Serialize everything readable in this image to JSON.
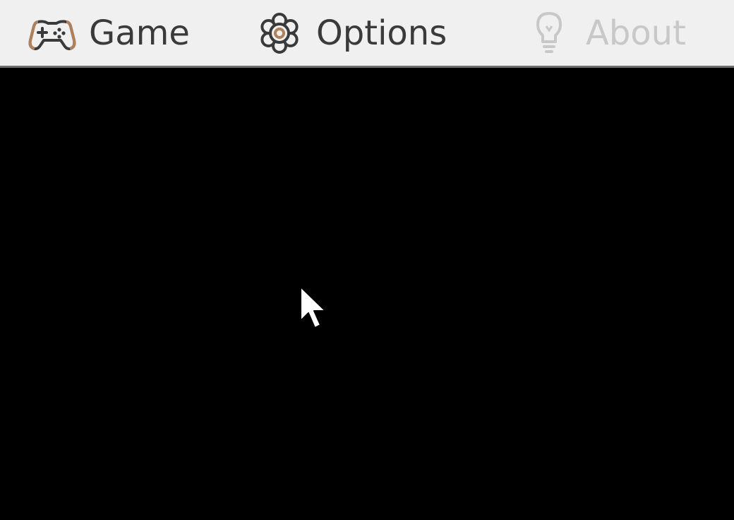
{
  "menubar": {
    "items": [
      {
        "label": "Game",
        "icon": "gamepad-icon",
        "enabled": true
      },
      {
        "label": "Options",
        "icon": "gear-icon",
        "enabled": true
      },
      {
        "label": "About",
        "icon": "lightbulb-icon",
        "enabled": false
      }
    ]
  },
  "colors": {
    "menubar_bg": "#f0f0f0",
    "menu_text": "#3a3a3a",
    "menu_text_disabled": "#c8c8c8",
    "canvas_bg": "#000000",
    "icon_accent": "#b0805a"
  },
  "canvas": {
    "cursor_icon": "mouse-pointer-icon"
  }
}
